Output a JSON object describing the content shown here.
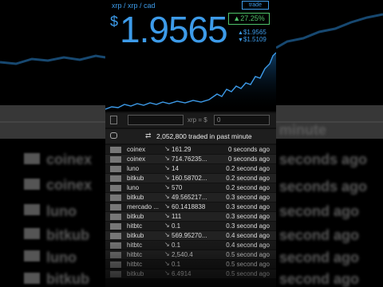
{
  "header": {
    "pair": "xrp / xrp / cad",
    "currency_symbol": "$",
    "price": "1.9565",
    "trade_label": "trade",
    "change": "▲27.25%",
    "high": "$1.9565",
    "low": "$1.5109"
  },
  "converter": {
    "label": "xrp = $",
    "value": "0"
  },
  "volume": {
    "text": "2,052,800  traded in past minute"
  },
  "trades": [
    {
      "exchange": "coinex",
      "amount": "161.29",
      "time": "0 seconds ago"
    },
    {
      "exchange": "coinex",
      "amount": "714.76235...",
      "time": "0 seconds ago"
    },
    {
      "exchange": "luno",
      "amount": "14",
      "time": "0.2 second ago"
    },
    {
      "exchange": "bitkub",
      "amount": "160.58702...",
      "time": "0.2 second ago"
    },
    {
      "exchange": "luno",
      "amount": "570",
      "time": "0.2 second ago"
    },
    {
      "exchange": "bitkub",
      "amount": "49.565217...",
      "time": "0.3 second ago"
    },
    {
      "exchange": "mercado ...",
      "amount": "60.1418838",
      "time": "0.3 second ago"
    },
    {
      "exchange": "bitkub",
      "amount": "111",
      "time": "0.3 second ago"
    },
    {
      "exchange": "hitbtc",
      "amount": "0.1",
      "time": "0.3 second ago"
    },
    {
      "exchange": "bitkub",
      "amount": "569.95270...",
      "time": "0.4 second ago"
    },
    {
      "exchange": "hitbtc",
      "amount": "0.1",
      "time": "0.4 second ago"
    },
    {
      "exchange": "hitbtc",
      "amount": "2,540.4",
      "time": "0.5 second ago"
    },
    {
      "exchange": "hitbtc",
      "amount": "0.1",
      "time": "0.5 second ago"
    },
    {
      "exchange": "bitkub",
      "amount": "6.4914",
      "time": "0.5 second ago"
    }
  ],
  "background": {
    "minute": "minute",
    "ago1": "seconds ago",
    "ago2": "seconds ago",
    "ago3": "second ago",
    "coinex1": "coinex",
    "coinex2": "coinex",
    "luno1": "luno",
    "bitkub1": "bitkub",
    "luno2": "luno",
    "bitkub2": "bitkub",
    "ago4": "second ago",
    "ago5": "second ago",
    "ago6": "second ago",
    "ago7": "second ago"
  },
  "colors": {
    "accent": "#3d9be9",
    "up": "#4fc36a"
  },
  "icons": [
    "calculator-icon",
    "chat-icon",
    "swap-icon",
    "flag-icon",
    "arrow-up-icon",
    "arrow-down-icon"
  ]
}
